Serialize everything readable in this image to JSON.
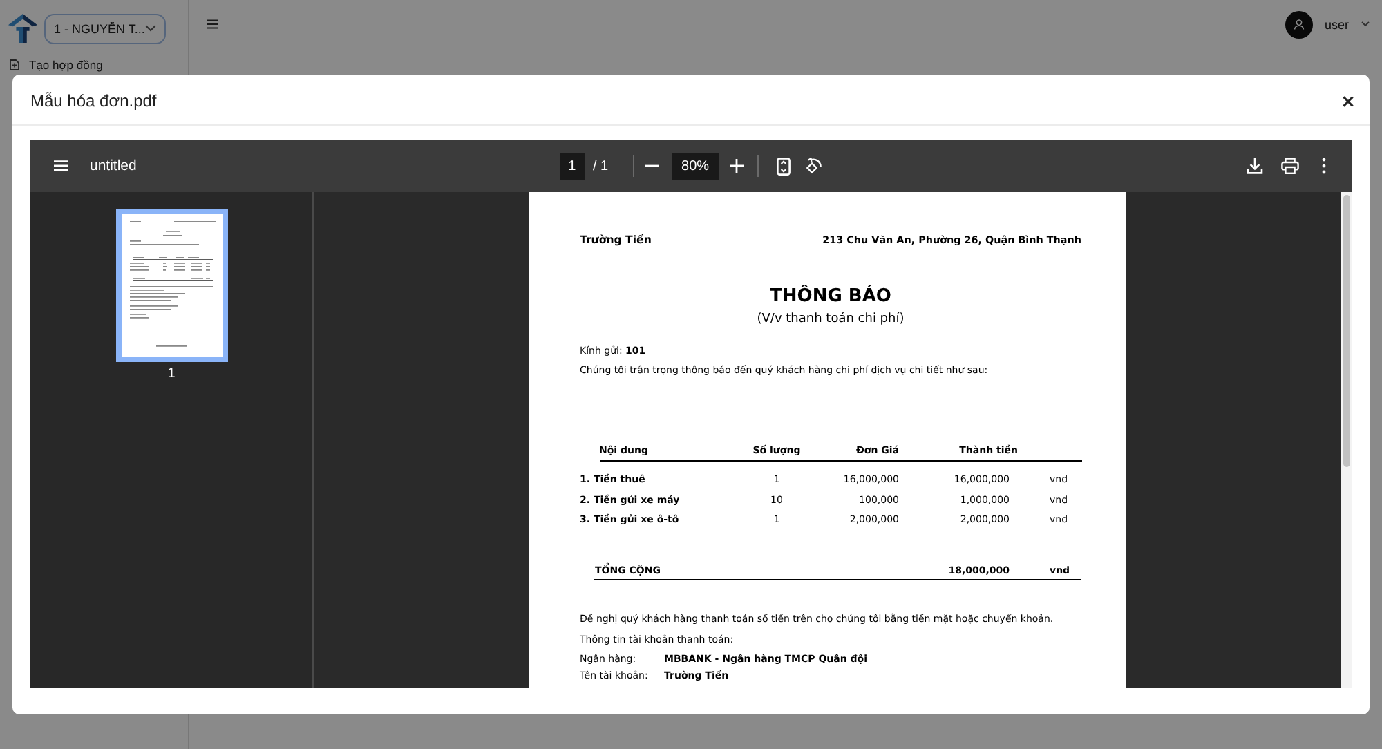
{
  "app": {
    "company_select": "1 - NGUYỄN T...",
    "sidebar_items": [
      {
        "label": "Tạo hợp đồng"
      }
    ],
    "user_name": "user"
  },
  "modal": {
    "title": "Mẫu hóa đơn.pdf"
  },
  "pdf_viewer": {
    "file_name": "untitled",
    "page_number": "1",
    "page_count": "/ 1",
    "zoom": "80%",
    "thumbnails": [
      {
        "label": "1",
        "selected": true
      }
    ]
  },
  "document": {
    "sender": "Trường Tiến",
    "address": "213 Chu Văn An, Phường 26, Quận Bình Thạnh",
    "title": "THÔNG BÁO",
    "subtitle": "(V/v thanh toán chi phí)",
    "greeting": "Kính gửi:  **101**",
    "intro": "Chúng tôi trân trọng thông báo đến quý khách hàng chi phí dịch vụ chi tiết như sau:",
    "table": {
      "columns": [
        "Nội dung",
        "Số lượng",
        "Đơn Giá",
        "Thành tiền"
      ],
      "rows": [
        {
          "item": "1. Tiền thuê",
          "quantity": "1",
          "unit_price": "16,000,000",
          "amount": "16,000,000",
          "currency": "vnd"
        },
        {
          "item": "2. Tiền gửi xe máy",
          "quantity": "10",
          "unit_price": "100,000",
          "amount": "1,000,000",
          "currency": "vnd"
        },
        {
          "item": "3. Tiền gửi xe ô-tô",
          "quantity": "1",
          "unit_price": "2,000,000",
          "amount": "2,000,000",
          "currency": "vnd"
        }
      ],
      "total": {
        "label": "TỔNG CỘNG",
        "amount": "18,000,000",
        "currency": "vnd"
      }
    },
    "request": "Đề nghị quý khách hàng thanh toán số tiền trên cho chúng tôi bằng tiền mặt hoặc chuyển khoản.",
    "account_heading": "Thông tin tài khoản thanh toán:",
    "account_details": [
      {
        "label": "Ngân hàng:",
        "value": "MBBANK - Ngân hàng TMCP Quân đội"
      },
      {
        "label": "Tên tài khoản:",
        "value": "Trường Tiến"
      }
    ]
  }
}
